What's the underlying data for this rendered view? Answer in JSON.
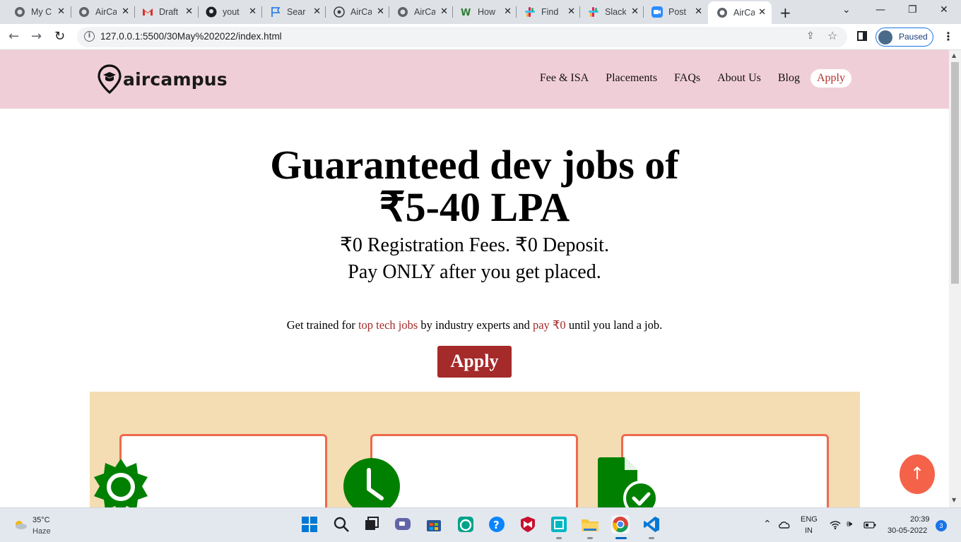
{
  "browser": {
    "tabs": [
      {
        "label": "My C",
        "icon": "globe-icon"
      },
      {
        "label": "AirCa",
        "icon": "globe-icon"
      },
      {
        "label": "Draft",
        "icon": "gmail-icon"
      },
      {
        "label": "yout",
        "icon": "github-icon"
      },
      {
        "label": "Sear",
        "icon": "flag-icon"
      },
      {
        "label": "AirCa",
        "icon": "chrome-ext-icon"
      },
      {
        "label": "AirCa",
        "icon": "globe-icon"
      },
      {
        "label": "How",
        "icon": "wikihow-icon"
      },
      {
        "label": "Find",
        "icon": "slack-icon"
      },
      {
        "label": "Slack",
        "icon": "slack-icon"
      },
      {
        "label": "Post",
        "icon": "zoom-icon"
      },
      {
        "label": "AirCa",
        "icon": "globe-icon",
        "active": true
      }
    ],
    "url": "127.0.0.1:5500/30May%202022/index.html",
    "profile_status": "Paused"
  },
  "site": {
    "logo_text": "aircampus",
    "nav": [
      "Fee & ISA",
      "Placements",
      "FAQs",
      "About Us",
      "Blog"
    ],
    "nav_apply": "Apply",
    "hero_line1": "Guaranteed dev jobs of",
    "hero_line2": "₹5-40 LPA",
    "sub_line1": "₹0 Registration Fees. ₹0 Deposit.",
    "sub_line2": "Pay ONLY after you get placed.",
    "tagline": {
      "part1": "Get trained for ",
      "hl1": "top tech jobs",
      "part2": " by industry experts and ",
      "hl2": "pay ₹0",
      "part3": " until you land a job."
    },
    "apply_button": "Apply",
    "feature_icons": [
      "gear-icon",
      "clock-icon",
      "document-check-icon"
    ],
    "scroll_top_icon": "arrow-up-icon",
    "colors": {
      "header_bg": "#f0ced8",
      "accent": "#a52a2a",
      "band_bg": "#f4ddb3",
      "card_border": "#ee6a4e",
      "icon_green": "#008000",
      "scroll_top_bg": "#f4624a"
    }
  },
  "taskbar": {
    "temperature": "35°C",
    "weather": "Haze",
    "lang_line1": "ENG",
    "lang_line2": "IN",
    "time": "20:39",
    "date": "30-05-2022",
    "notifications": "3"
  }
}
